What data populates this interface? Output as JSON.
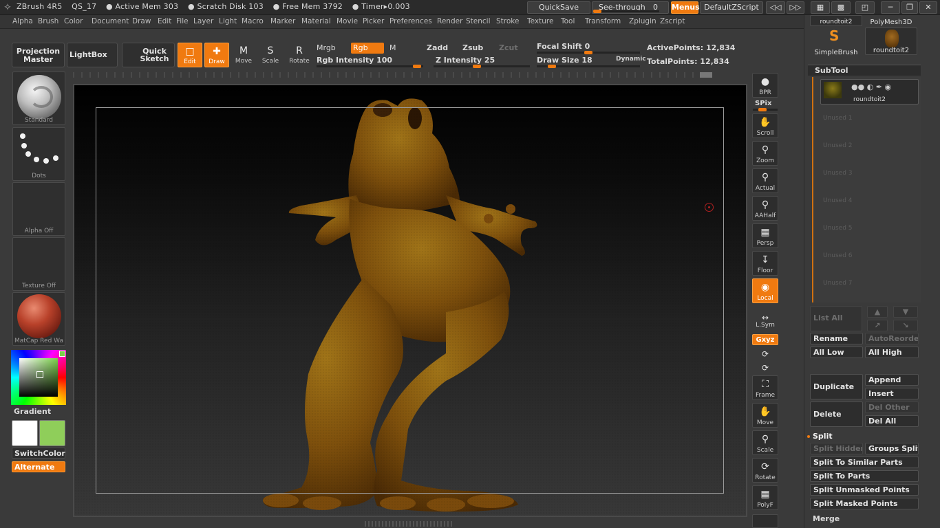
{
  "titlebar": {
    "app": "ZBrush 4R5",
    "doc": "QS_17",
    "active_mem": "● Active Mem 303",
    "scratch_disk": "● Scratch Disk 103",
    "free_mem": "● Free Mem 3792",
    "timer": "● Timer▸0.003",
    "quicksave": "QuickSave",
    "see_through": "See-through",
    "see_through_value": "0",
    "menus": "Menus",
    "script": "DefaultZScript"
  },
  "menu": [
    "Alpha",
    "Brush",
    "Color",
    "Document",
    "Draw",
    "Edit",
    "File",
    "Layer",
    "Light",
    "Macro",
    "Marker",
    "Material",
    "Movie",
    "Picker",
    "Preferences",
    "Render",
    "Stencil",
    "Stroke",
    "Texture",
    "Tool",
    "Transform",
    "Zplugin",
    "Zscript"
  ],
  "shelf": {
    "projection_master_1": "Projection",
    "projection_master_2": "Master",
    "lightbox": "LightBox",
    "quick_sketch_1": "Quick",
    "quick_sketch_2": "Sketch",
    "edit": "Edit",
    "draw": "Draw",
    "move": "Move",
    "scale": "Scale",
    "rotate": "Rotate",
    "mrgb": "Mrgb",
    "rgb": "Rgb",
    "m": "M",
    "zadd": "Zadd",
    "zsub": "Zsub",
    "zcut": "Zcut",
    "rgb_intensity": "Rgb Intensity 100",
    "z_intensity": "Z Intensity 25",
    "focal_shift": "Focal Shift 0",
    "draw_size": "Draw Size 18",
    "dynamic": "Dynamic",
    "active_points": "ActivePoints: 12,834",
    "total_points": "TotalPoints: 12,834"
  },
  "left": {
    "brush": "Standard",
    "stroke": "Dots",
    "alpha": "Alpha  Off",
    "texture": "Texture  Off",
    "material": "MatCap  Red  Wa",
    "gradient": "Gradient",
    "switch_color": "SwitchColor",
    "alternate": "Alternate",
    "main_color": "#ffffff",
    "secondary_color": "#8fce5a"
  },
  "right_strip": {
    "bpr": "BPR",
    "spix": "SPix",
    "scroll": "Scroll",
    "zoom": "Zoom",
    "actual": "Actual",
    "aahalf": "AAHalf",
    "persp": "Persp",
    "floor": "Floor",
    "local": "Local",
    "lsym": "L.Sym",
    "xyz": "Gxyz",
    "frame": "Frame",
    "move": "Move",
    "scale": "Scale",
    "rotate": "Rotate",
    "polyf": "PolyF"
  },
  "tool_palette": {
    "roundtoit_top": "roundtoit2",
    "polymesh": "PolyMesh3D",
    "simplebrush": "SimpleBrush",
    "roundtoit": "roundtoit2"
  },
  "subtool": {
    "title": "SubTool",
    "active_item": "roundtoit2",
    "unused": [
      "Unused  1",
      "Unused  2",
      "Unused  3",
      "Unused  4",
      "Unused  5",
      "Unused  6",
      "Unused  7"
    ],
    "list_all": "List  All",
    "rename": "Rename",
    "autoreorder": "AutoReorder",
    "all_low": "All  Low",
    "all_high": "All  High",
    "duplicate": "Duplicate",
    "append": "Append",
    "insert": "Insert",
    "delete": "Delete",
    "del_other": "Del  Other",
    "del_all": "Del  All",
    "split": "Split",
    "split_hidden": "Split  Hidden",
    "groups_split": "Groups  Split",
    "split_similar": "Split  To  Similar  Parts",
    "split_parts": "Split  To  Parts",
    "split_unmasked": "Split  Unmasked  Points",
    "split_masked": "Split  Masked  Points",
    "merge": "Merge"
  },
  "colors": {
    "accent": "#f07a10",
    "model": "#8a5a10"
  }
}
